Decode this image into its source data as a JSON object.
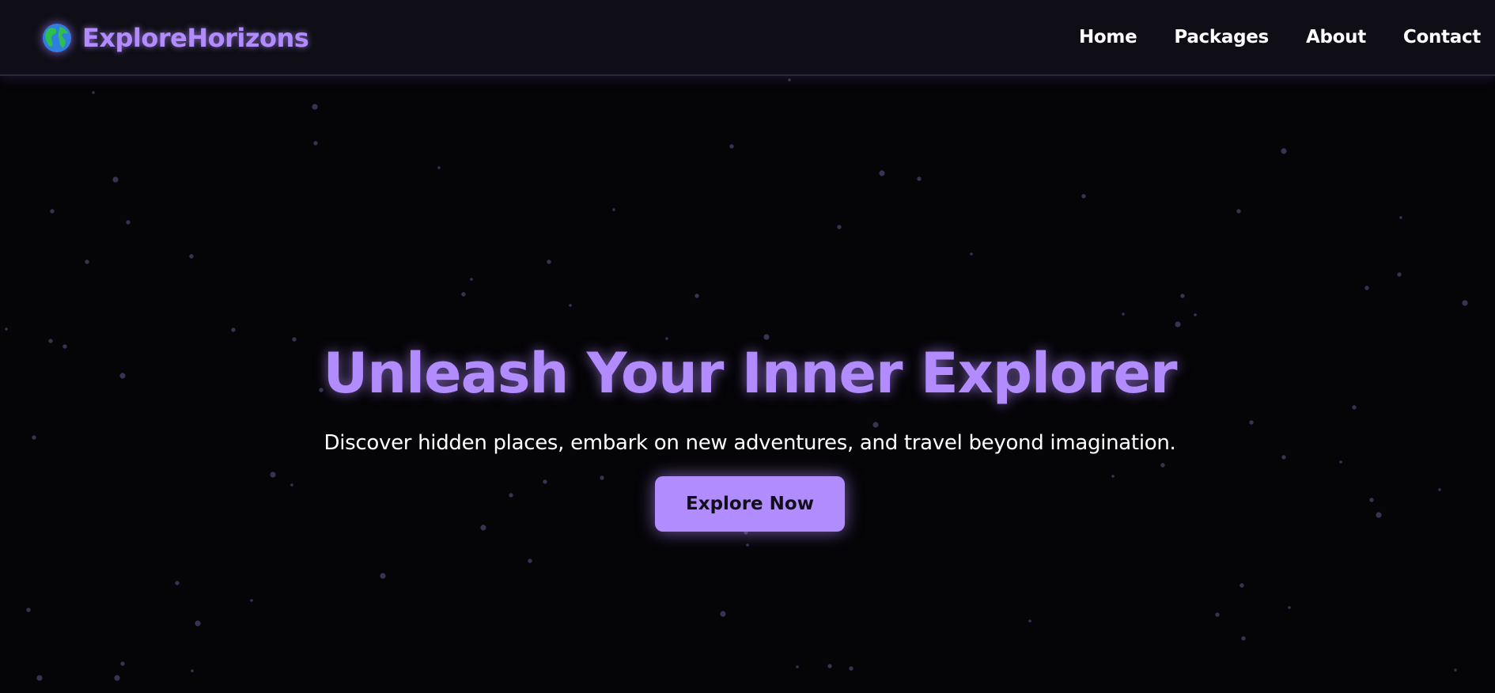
{
  "brand": {
    "name": "ExploreHorizons",
    "icon": "globe-icon"
  },
  "nav": {
    "links": [
      "Home",
      "Packages",
      "About",
      "Contact"
    ]
  },
  "hero": {
    "title": "Unleash Your Inner Explorer",
    "subtitle": "Discover hidden places, embark on new adventures, and travel beyond imagination.",
    "cta_label": "Explore Now"
  },
  "colors": {
    "accent": "#b28bff",
    "background": "#050407",
    "navbar": "#0f0e16",
    "star": "#3a3a5c"
  }
}
